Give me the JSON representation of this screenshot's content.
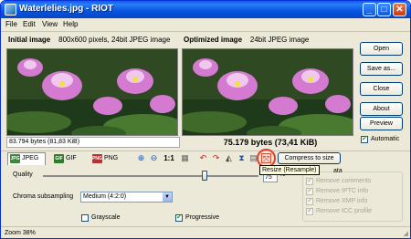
{
  "window": {
    "title": "Waterlelies.jpg - RIOT"
  },
  "titlebar_buttons": {
    "minimize": "_",
    "maximize": "□",
    "close": "✕"
  },
  "menu": [
    "File",
    "Edit",
    "View",
    "Help"
  ],
  "initial": {
    "title": "Initial image",
    "meta": "800x600 pixels, 24bit JPEG image",
    "size": "83.794 bytes (81,83 KiB)"
  },
  "optimized": {
    "title": "Optimized image",
    "meta": "24bit JPEG image",
    "size": "75.179 bytes (73,41 KiB)"
  },
  "right_buttons": {
    "open": "Open",
    "save_as": "Save as...",
    "close": "Close",
    "about": "About",
    "preview": "Preview"
  },
  "automatic": {
    "label": "Automatic",
    "checked": true
  },
  "format_tabs": [
    {
      "label": "JPEG",
      "icon": "jpeg-icon",
      "active": true
    },
    {
      "label": "GIF",
      "icon": "gif-icon",
      "active": false
    },
    {
      "label": "PNG",
      "icon": "png-icon",
      "active": false
    }
  ],
  "toolbar": {
    "zoom_in": "zoom-in-icon",
    "zoom_out": "zoom-out-icon",
    "one_to_one": "1:1",
    "compress_to_size": "Compress to size",
    "resize_tooltip": "Resize (Resample)"
  },
  "quality": {
    "label": "Quality",
    "value": "75",
    "unit": "%",
    "level": 0.75
  },
  "chroma": {
    "label": "Chroma subsampling",
    "selected": "Medium (4:2:0)"
  },
  "grayscale": {
    "label": "Grayscale",
    "checked": false
  },
  "progressive": {
    "label": "Progressive",
    "checked": true
  },
  "metadata": {
    "title_fragment": "ata",
    "items": [
      {
        "label": "Remove comments",
        "checked": true
      },
      {
        "label": "Remove IPTC info",
        "checked": true
      },
      {
        "label": "Remove XMP info",
        "checked": true
      },
      {
        "label": "Remove ICC profile",
        "checked": true
      }
    ]
  },
  "statusbar": {
    "zoom": "Zoom 38%"
  },
  "colors": {
    "titlebar": "#0a5fe8",
    "window_bg": "#ece9d8",
    "highlight_circle": "#e03a2c"
  }
}
